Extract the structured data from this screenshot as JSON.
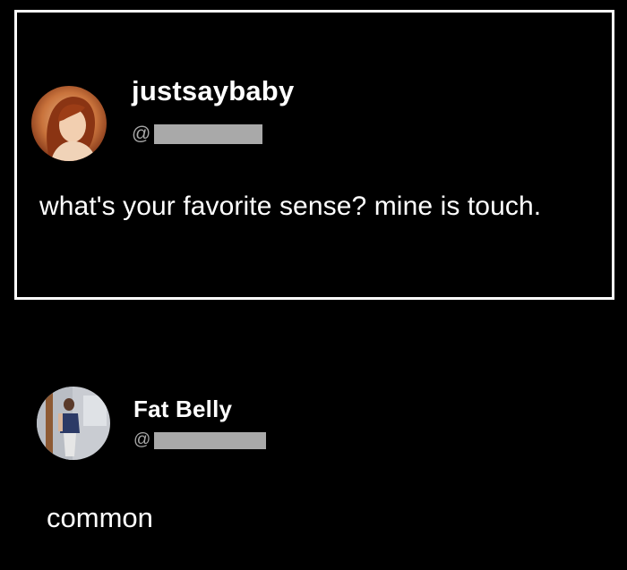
{
  "tweet": {
    "username": "justsaybaby",
    "handle_prefix": "@",
    "text": "what's your favorite sense? mine is touch.",
    "avatar_icon": "profile-photo-woman-red-hair"
  },
  "reply": {
    "username": "Fat Belly",
    "handle_prefix": "@",
    "text": "common",
    "avatar_icon": "profile-photo-person-standing"
  },
  "colors": {
    "background": "#000000",
    "text": "#ffffff",
    "handle": "#a8a8a8",
    "redaction": "#a9a9a9",
    "frame_border": "#ffffff"
  }
}
